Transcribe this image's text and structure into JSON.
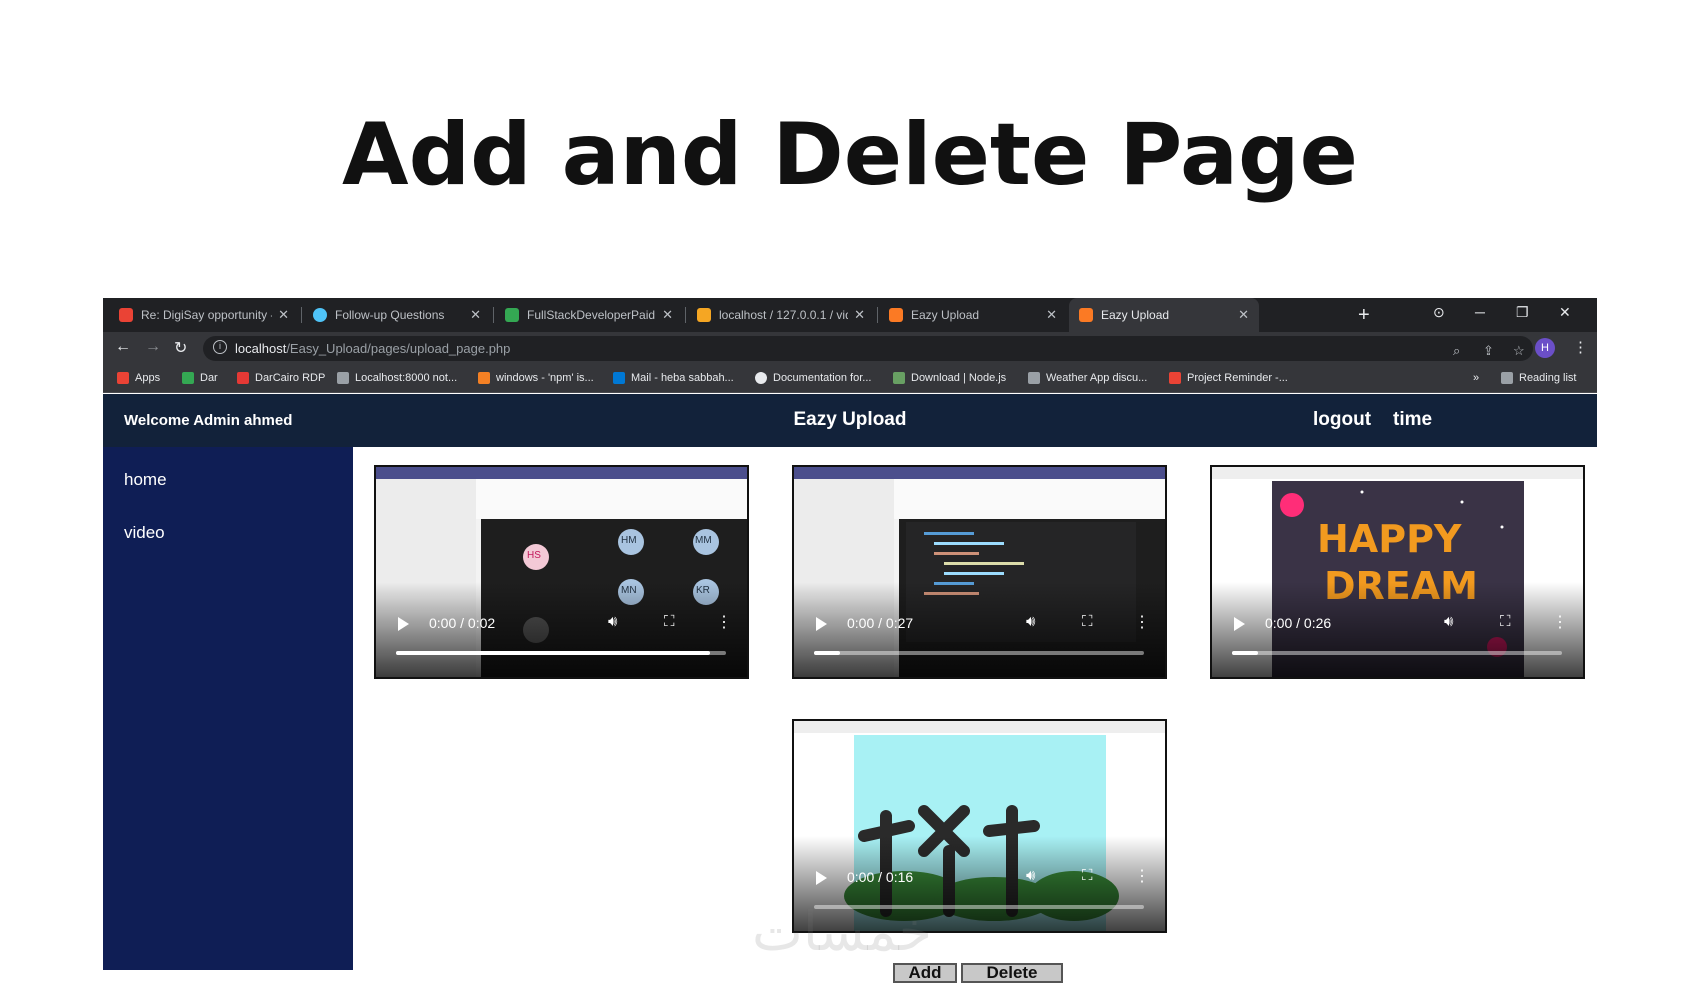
{
  "slide": {
    "title": "Add and Delete Page"
  },
  "browser": {
    "tabs": [
      {
        "label": "Re: DigiSay opportunity - h",
        "icon": "gmail-icon",
        "color": "#ea4335"
      },
      {
        "label": "Follow-up Questions",
        "icon": "globe-icon",
        "color": "#4fc3f7"
      },
      {
        "label": "FullStackDeveloperPaidInte",
        "icon": "google-drive-icon",
        "color": "#34a853"
      },
      {
        "label": "localhost / 127.0.0.1 / vide",
        "icon": "phpmyadmin-icon",
        "color": "#f5a623"
      },
      {
        "label": "Eazy Upload",
        "icon": "xampp-icon",
        "color": "#fb7a24"
      },
      {
        "label": "Eazy Upload",
        "icon": "xampp-icon",
        "color": "#fb7a24"
      }
    ],
    "address": {
      "host": "localhost",
      "path": "/Easy_Upload/pages/upload_page.php"
    },
    "profile_initial": "H",
    "bookmarks": [
      {
        "label": "Apps",
        "color": "#ea4335"
      },
      {
        "label": "Dar",
        "color": "#34a853"
      },
      {
        "label": "DarCairo RDP",
        "color": "#e53935"
      },
      {
        "label": "Localhost:8000 not...",
        "color": "#9aa0a6"
      },
      {
        "label": "windows - 'npm' is...",
        "color": "#f48024"
      },
      {
        "label": "Mail - heba sabbah...",
        "color": "#0078d4"
      },
      {
        "label": "Documentation for...",
        "color": "#e8eaed"
      },
      {
        "label": "Download | Node.js",
        "color": "#68a063"
      },
      {
        "label": "Weather App discu...",
        "color": "#9aa0a6"
      },
      {
        "label": "Project Reminder -...",
        "color": "#ea4335"
      }
    ],
    "reading_list": "Reading list",
    "more_bookmarks": "»"
  },
  "app": {
    "welcome": "Welcome Admin ahmed",
    "title": "Eazy Upload",
    "logout": "logout",
    "time": "time",
    "sidebar": {
      "home": "home",
      "video": "video"
    },
    "videos": [
      {
        "time": "0:00 / 0:02",
        "progress": 0.95
      },
      {
        "time": "0:00 / 0:27",
        "progress": 0.08
      },
      {
        "time": "0:00 / 0:26",
        "progress": 0.08
      },
      {
        "time": "0:00 / 0:16",
        "progress": 0.0
      }
    ],
    "video1_avatars": [
      "HS",
      "HM",
      "MM",
      "MN",
      "KR",
      "MK"
    ],
    "video3_text": [
      "HAPPY",
      "DREAM"
    ],
    "add_label": "Add",
    "delete_label": "Delete"
  },
  "watermark": "خمسات"
}
